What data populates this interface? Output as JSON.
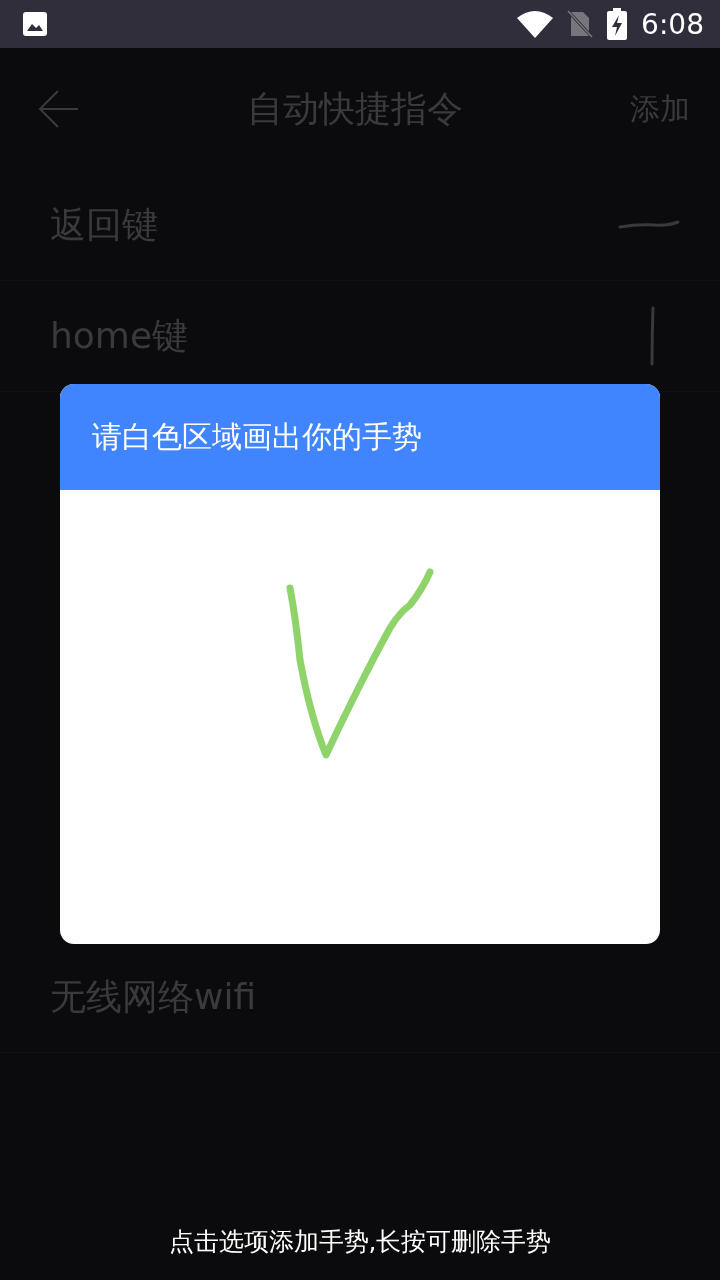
{
  "status_bar": {
    "time": "6:08"
  },
  "app_bar": {
    "title": "自动快捷指令",
    "action": "添加"
  },
  "items_above_dialog": [
    {
      "label": "返回键",
      "kind": "dash"
    },
    {
      "label": "home键",
      "kind": "vertical"
    }
  ],
  "items_below_dialog": [
    {
      "label": "无线网络wifi"
    }
  ],
  "dialog": {
    "title": "请白色区域画出你的手势"
  },
  "hint": "点击选项添加手势,长按可删除手势"
}
